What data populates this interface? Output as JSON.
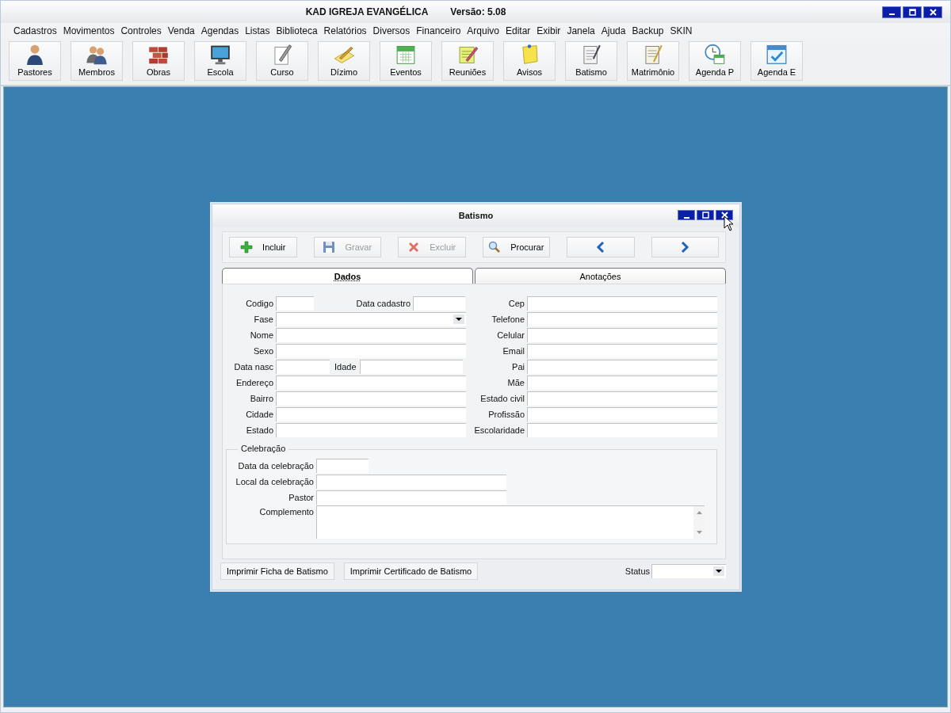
{
  "window": {
    "title": "KAD IGREJA EVANGÉLICA",
    "version": "Versão: 5.08"
  },
  "menu": [
    "Cadastros",
    "Movimentos",
    "Controles",
    "Venda",
    "Agendas",
    "Listas",
    "Biblioteca",
    "Relatórios",
    "Diversos",
    "Financeiro",
    "Arquivo",
    "Editar",
    "Exibir",
    "Janela",
    "Ajuda",
    "Backup",
    "SKIN"
  ],
  "toolbar": [
    "Pastores",
    "Membros",
    "Obras",
    "Escola",
    "Curso",
    "Dízimo",
    "Eventos",
    "Reuniões",
    "Avisos",
    "Batismo",
    "Matrimônio",
    "Agenda P",
    "Agenda E"
  ],
  "dialog": {
    "title": "Batismo",
    "actions": [
      {
        "kind": "add",
        "label": "Incluir",
        "disabled": false
      },
      {
        "kind": "save",
        "label": "Gravar",
        "disabled": true
      },
      {
        "kind": "delete",
        "label": "Excluir",
        "disabled": true
      },
      {
        "kind": "search",
        "label": "Procurar",
        "disabled": false
      },
      {
        "kind": "prev",
        "disabled": false
      },
      {
        "kind": "next",
        "disabled": false
      }
    ],
    "tabs": [
      {
        "label": "Dados",
        "selected": true
      },
      {
        "label": "Anotações",
        "selected": false
      }
    ],
    "left_fields": [
      {
        "kind": "pair",
        "label": "Codigo",
        "second_label": "Data cadastro"
      },
      {
        "kind": "select",
        "label": "Fase"
      },
      {
        "kind": "text",
        "label": "Nome"
      },
      {
        "kind": "text",
        "label": "Sexo"
      },
      {
        "kind": "pair2",
        "label": "Data nasc",
        "second_label": "Idade"
      },
      {
        "kind": "text",
        "label": "Endereço"
      },
      {
        "kind": "text",
        "label": "Bairro"
      },
      {
        "kind": "text",
        "label": "Cidade"
      },
      {
        "kind": "text",
        "label": "Estado"
      }
    ],
    "right_fields": [
      "Cep",
      "Telefone",
      "Celular",
      "Email",
      "Pai",
      "Mãe",
      "Estado civil",
      "Profissão",
      "Escolaridade"
    ],
    "celebration": {
      "legend": "Celebração",
      "fields": [
        {
          "kind": "short",
          "label": "Data da celebração"
        },
        {
          "kind": "medium",
          "label": "Local da celebração"
        },
        {
          "kind": "medium",
          "label": "Pastor"
        },
        {
          "kind": "memo",
          "label": "Complemento"
        }
      ]
    },
    "print_buttons": [
      "Imprimir Ficha de Batismo",
      "Imprimir Certificado de Batismo"
    ],
    "status": {
      "label": "Status"
    }
  }
}
